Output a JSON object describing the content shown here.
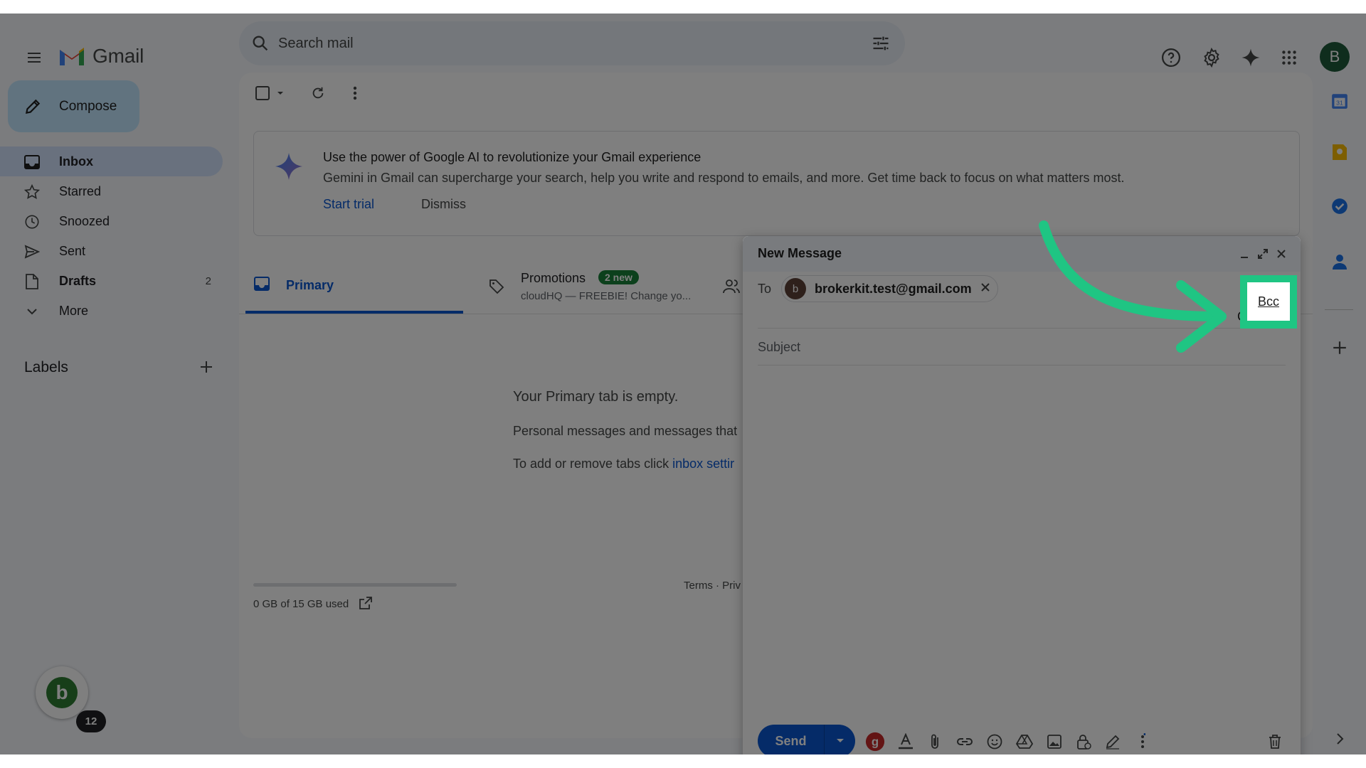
{
  "app": {
    "name": "Gmail"
  },
  "search": {
    "placeholder": "Search mail"
  },
  "user": {
    "initial": "B"
  },
  "sidebar": {
    "compose_label": "Compose",
    "items": [
      {
        "label": "Inbox",
        "count": ""
      },
      {
        "label": "Starred",
        "count": ""
      },
      {
        "label": "Snoozed",
        "count": ""
      },
      {
        "label": "Sent",
        "count": ""
      },
      {
        "label": "Drafts",
        "count": "2"
      },
      {
        "label": "More",
        "count": ""
      }
    ],
    "labels_heading": "Labels"
  },
  "promo": {
    "title": "Use the power of Google AI to revolutionize your Gmail experience",
    "description": "Gemini in Gmail can supercharge your search, help you write and respond to emails, and more. Get time back to focus on what matters most.",
    "start_trial": "Start trial",
    "dismiss": "Dismiss"
  },
  "tabs": {
    "primary": "Primary",
    "promotions": "Promotions",
    "promotions_badge": "2 new",
    "promotions_snippet": "cloudHQ — FREEBIE! Change yo..."
  },
  "empty": {
    "title": "Your Primary tab is empty.",
    "line1": "Personal messages and messages that",
    "line2_prefix": "To add or remove tabs click ",
    "line2_link": "inbox settir"
  },
  "storage": {
    "text": "0 GB of 15 GB used",
    "fill": 0
  },
  "footer": {
    "terms": "Terms · Priv"
  },
  "compose": {
    "title": "New Message",
    "to_label": "To",
    "recipient_initial": "b",
    "recipient": "brokerkit.test@gmail.com",
    "cc_label": "Cc",
    "bcc_label": "Bcc",
    "subject_placeholder": "Subject",
    "send_label": "Send"
  },
  "floating": {
    "avatar_initial": "b",
    "badge": "12"
  },
  "colors": {
    "accent": "#0b57d0",
    "highlight": "#1fc583",
    "compose_bg": "#c2e7ff"
  }
}
